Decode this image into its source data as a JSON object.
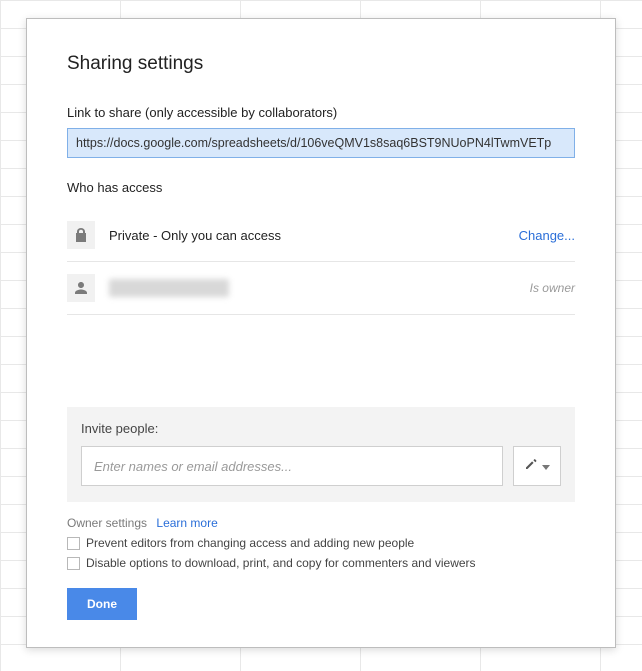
{
  "dialog": {
    "title": "Sharing settings",
    "link_label": "Link to share (only accessible by collaborators)",
    "link_value": "https://docs.google.com/spreadsheets/d/106veQMV1s8saq6BST9NUoPN4lTwmVETp",
    "who_label": "Who has access",
    "access": {
      "privacy_text": "Private - Only you can access",
      "change_label": "Change...",
      "owner_role": "Is owner"
    },
    "invite": {
      "label": "Invite people:",
      "placeholder": "Enter names or email addresses..."
    },
    "owner_settings": {
      "label": "Owner settings",
      "learn_more": "Learn more",
      "option1": "Prevent editors from changing access and adding new people",
      "option2": "Disable options to download, print, and copy for commenters and viewers"
    },
    "done_label": "Done"
  }
}
